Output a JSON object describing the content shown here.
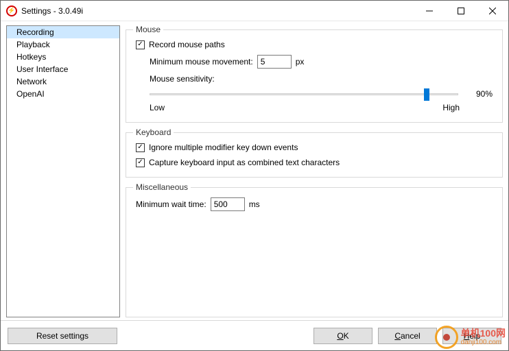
{
  "window": {
    "title": "Settings - 3.0.49i"
  },
  "sidebar": {
    "items": [
      {
        "label": "Recording",
        "selected": true
      },
      {
        "label": "Playback",
        "selected": false
      },
      {
        "label": "Hotkeys",
        "selected": false
      },
      {
        "label": "User Interface",
        "selected": false
      },
      {
        "label": "Network",
        "selected": false
      },
      {
        "label": "OpenAI",
        "selected": false
      }
    ]
  },
  "groups": {
    "mouse": {
      "legend": "Mouse",
      "record_paths_label": "Record mouse paths",
      "record_paths_checked": true,
      "min_move_label": "Minimum mouse movement:",
      "min_move_value": "5",
      "min_move_unit": "px",
      "sensitivity_label": "Mouse sensitivity:",
      "sensitivity_value": "90%",
      "sensitivity_percent": 90,
      "low_label": "Low",
      "high_label": "High"
    },
    "keyboard": {
      "legend": "Keyboard",
      "ignore_modifier_label": "Ignore multiple modifier key down events",
      "ignore_modifier_checked": true,
      "capture_combined_label": "Capture keyboard input as combined text characters",
      "capture_combined_checked": true
    },
    "misc": {
      "legend": "Miscellaneous",
      "min_wait_label": "Minimum wait time:",
      "min_wait_value": "500",
      "min_wait_unit": "ms"
    }
  },
  "buttons": {
    "reset": "Reset settings",
    "ok": "OK",
    "cancel": "Cancel",
    "help": "Help"
  },
  "watermark": {
    "line1": "单机100网",
    "line2": "danji100.com"
  }
}
